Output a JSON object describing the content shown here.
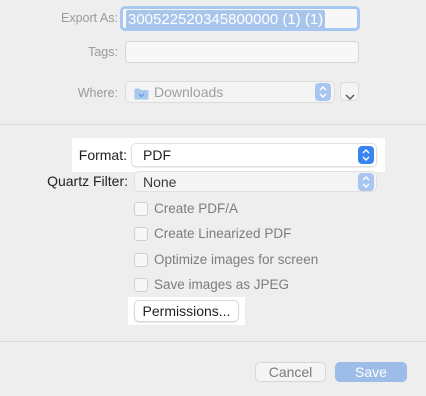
{
  "export_as": {
    "label": "Export As:",
    "value": "300522520345800000 (1) (1)"
  },
  "tags": {
    "label": "Tags:",
    "value": ""
  },
  "where": {
    "label": "Where:",
    "value": "Downloads",
    "icon": "folder-icon"
  },
  "format": {
    "label": "Format:",
    "value": "PDF"
  },
  "quartz_filter": {
    "label": "Quartz Filter:",
    "value": "None"
  },
  "options": [
    {
      "label": "Create PDF/A",
      "checked": false
    },
    {
      "label": "Create Linearized PDF",
      "checked": false
    },
    {
      "label": "Optimize images for screen",
      "checked": false
    },
    {
      "label": "Save images as JPEG",
      "checked": false
    }
  ],
  "permissions_label": "Permissions...",
  "footer": {
    "cancel_label": "Cancel",
    "save_label": "Save"
  },
  "colors": {
    "accent": "#3a86f0",
    "highlight_box": "#ffffff",
    "background": "#eeeeee"
  }
}
